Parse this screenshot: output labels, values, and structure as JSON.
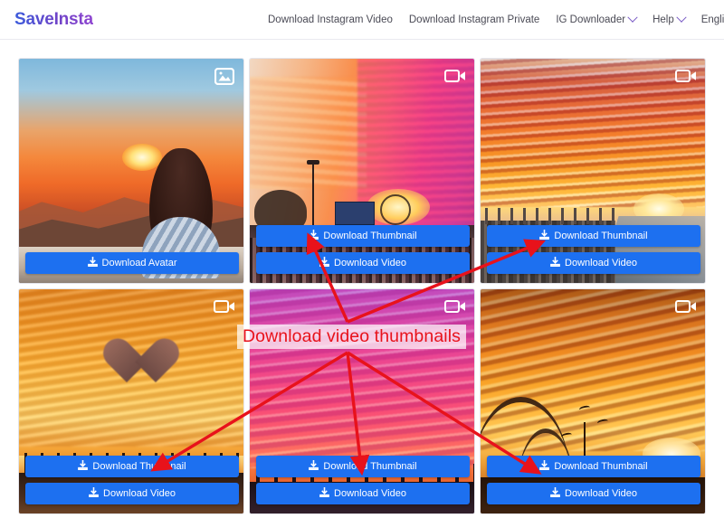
{
  "header": {
    "logo": "SaveInsta",
    "nav": [
      {
        "label": "Download Instagram Video",
        "caret": false
      },
      {
        "label": "Download Instagram Private",
        "caret": false
      },
      {
        "label": "IG Downloader",
        "caret": true
      },
      {
        "label": "Help",
        "caret": true
      },
      {
        "label": "English",
        "caret": true
      }
    ]
  },
  "colors": {
    "button_blue": "#1d70f0",
    "annotation_red": "#e8121b",
    "logo_gradient_start": "#3b5bdb",
    "logo_gradient_end": "#8e44d0",
    "nav_text": "#4a4a55",
    "card_border": "#e4e4ea"
  },
  "cards": [
    {
      "id": "card-1",
      "media_type": "image",
      "badge_icon": "image-icon",
      "alt": "Woman watching orange sunset over mountains",
      "buttons": [
        {
          "label": "Download Avatar",
          "icon": "download-icon",
          "kind": "avatar"
        }
      ]
    },
    {
      "id": "card-2",
      "media_type": "video",
      "badge_icon": "video-camera-icon",
      "alt": "Crowded street festival at sunset with pink and orange sky",
      "buttons": [
        {
          "label": "Download Thumbnail",
          "icon": "download-icon",
          "kind": "thumbnail"
        },
        {
          "label": "Download Video",
          "icon": "download-icon",
          "kind": "video"
        }
      ]
    },
    {
      "id": "card-3",
      "media_type": "video",
      "badge_icon": "video-camera-icon",
      "alt": "Aerial city skyline under fiery red cloud bands at sunset",
      "buttons": [
        {
          "label": "Download Thumbnail",
          "icon": "download-icon",
          "kind": "thumbnail"
        },
        {
          "label": "Download Video",
          "icon": "download-icon",
          "kind": "video"
        }
      ]
    },
    {
      "id": "card-4",
      "media_type": "video",
      "badge_icon": "video-camera-icon",
      "alt": "Heart shaped cloud in a golden orange sunset above a city",
      "buttons": [
        {
          "label": "Download Thumbnail",
          "icon": "download-icon",
          "kind": "thumbnail"
        },
        {
          "label": "Download Video",
          "icon": "download-icon",
          "kind": "video"
        }
      ]
    },
    {
      "id": "card-5",
      "media_type": "video",
      "badge_icon": "video-camera-icon",
      "alt": "Vivid magenta and pink sunset clouds over a city silhouette",
      "buttons": [
        {
          "label": "Download Thumbnail",
          "icon": "download-icon",
          "kind": "thumbnail"
        },
        {
          "label": "Download Video",
          "icon": "download-icon",
          "kind": "video"
        }
      ]
    },
    {
      "id": "card-6",
      "media_type": "video",
      "badge_icon": "video-camera-icon",
      "alt": "Bridge and city under burning gold clouds at sunset",
      "buttons": [
        {
          "label": "Download Thumbnail",
          "icon": "download-icon",
          "kind": "thumbnail"
        },
        {
          "label": "Download Video",
          "icon": "download-icon",
          "kind": "video"
        }
      ]
    }
  ],
  "annotation": {
    "label": "Download video thumbnails",
    "color": "#e8121b",
    "arrow_count": 5,
    "arrow_targets": [
      "card-2 Download Thumbnail",
      "card-3 Download Thumbnail",
      "card-4 Download Thumbnail",
      "card-5 Download Thumbnail",
      "card-6 Download Thumbnail"
    ]
  }
}
